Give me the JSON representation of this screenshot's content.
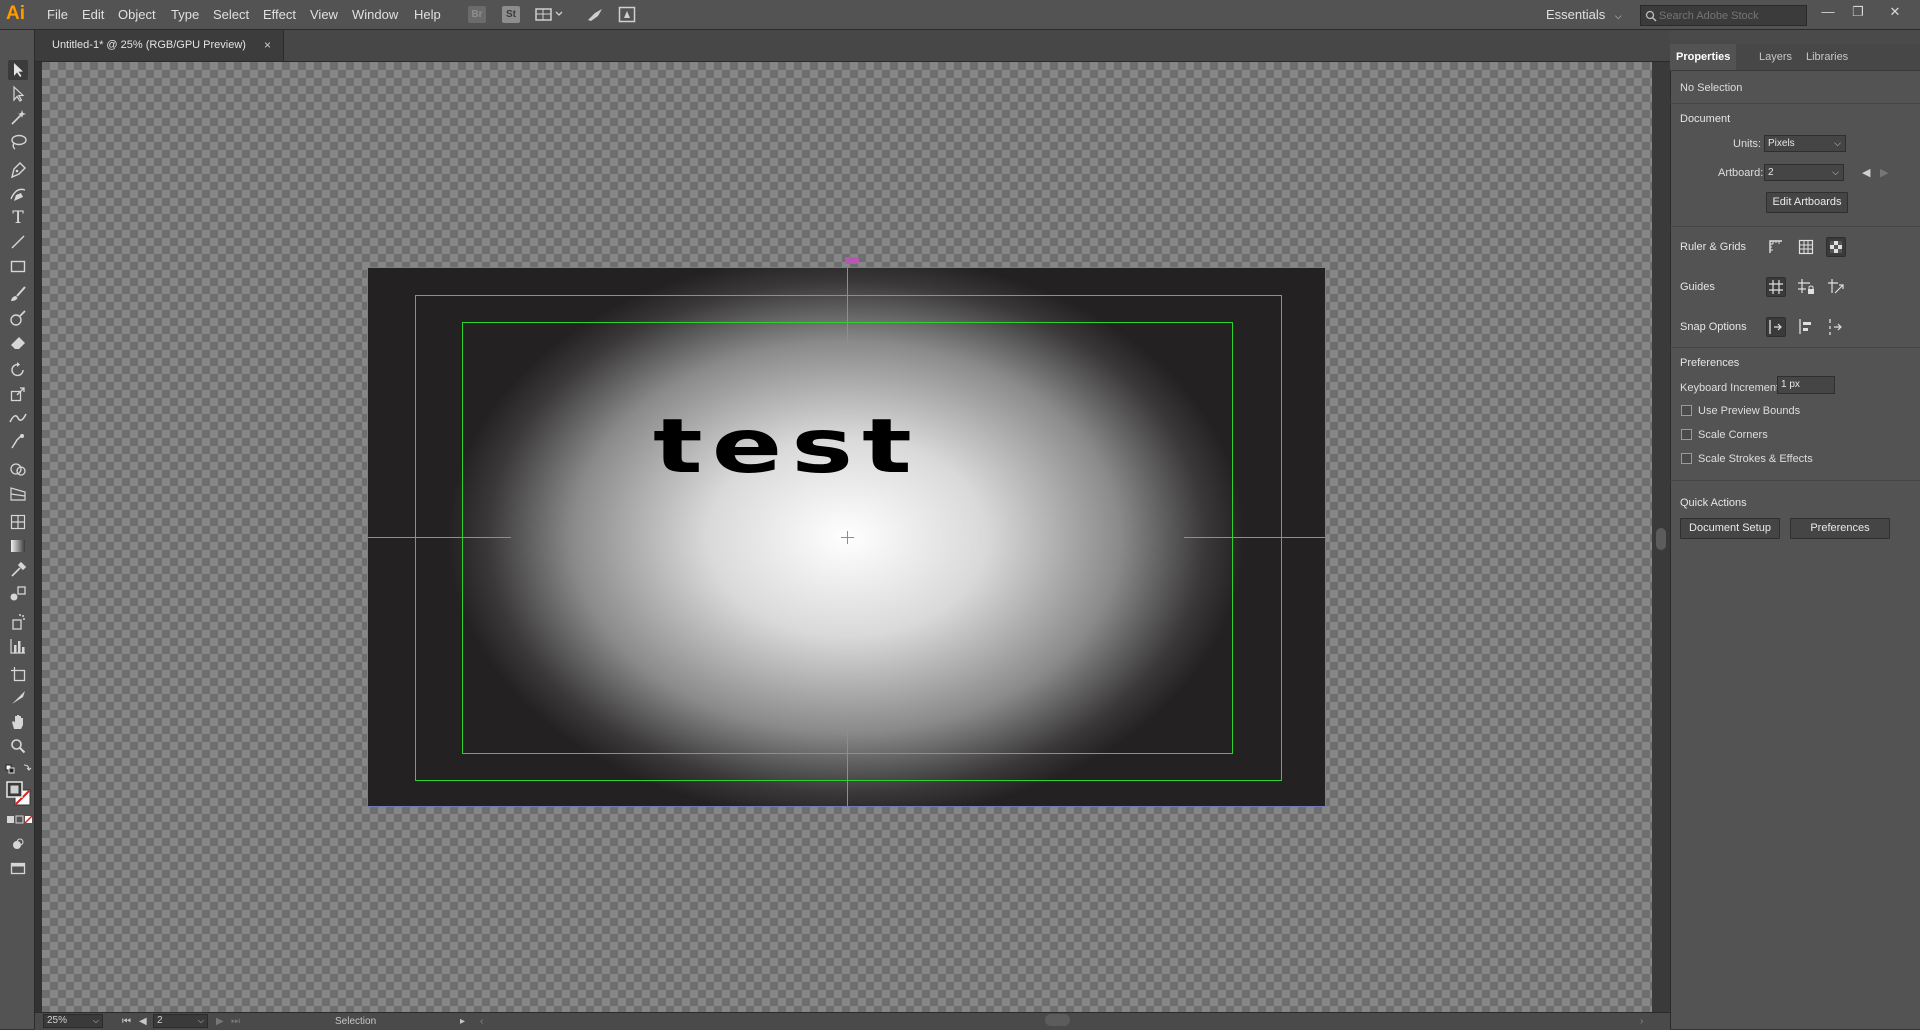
{
  "app": {
    "logo": "Ai"
  },
  "menu": [
    "File",
    "Edit",
    "Object",
    "Type",
    "Select",
    "Effect",
    "View",
    "Window",
    "Help"
  ],
  "toolbar_icons": [
    "bridge-icon",
    "stock-icon",
    "arrange-documents-icon",
    "gpu-performance-icon",
    "workspace-icon"
  ],
  "toolbar_icon_labels": {
    "bridge": "Br",
    "stock": "St"
  },
  "workspace": {
    "label": "Essentials"
  },
  "search": {
    "placeholder": "Search Adobe Stock"
  },
  "window_controls": {
    "minimize": "—",
    "restore": "❐",
    "close": "✕"
  },
  "document_tab": {
    "title": "Untitled-1* @ 25% (RGB/GPU Preview)",
    "close": "×"
  },
  "artwork": {
    "text": "test"
  },
  "status_bar": {
    "zoom": "25%",
    "artboard": "2",
    "tool": "Selection"
  },
  "properties_panel": {
    "tabs": [
      "Properties",
      "Layers",
      "Libraries"
    ],
    "selection": "No Selection",
    "document_heading": "Document",
    "units_label": "Units:",
    "units_value": "Pixels",
    "artboard_label": "Artboard:",
    "artboard_value": "2",
    "edit_artboards": "Edit Artboards",
    "rulers_grids": "Ruler & Grids",
    "guides": "Guides",
    "snap_options": "Snap Options",
    "preferences_heading": "Preferences",
    "keyboard_increment_label": "Keyboard Increment:",
    "keyboard_increment_value": "1 px",
    "checkboxes": [
      "Use Preview Bounds",
      "Scale Corners",
      "Scale Strokes & Effects"
    ],
    "quick_actions": "Quick Actions",
    "document_setup": "Document Setup",
    "preferences_button": "Preferences"
  },
  "colors": {
    "guide": "#2bd42b",
    "artboard_border": "#6f7cb8",
    "logo": "#ff9a00"
  }
}
